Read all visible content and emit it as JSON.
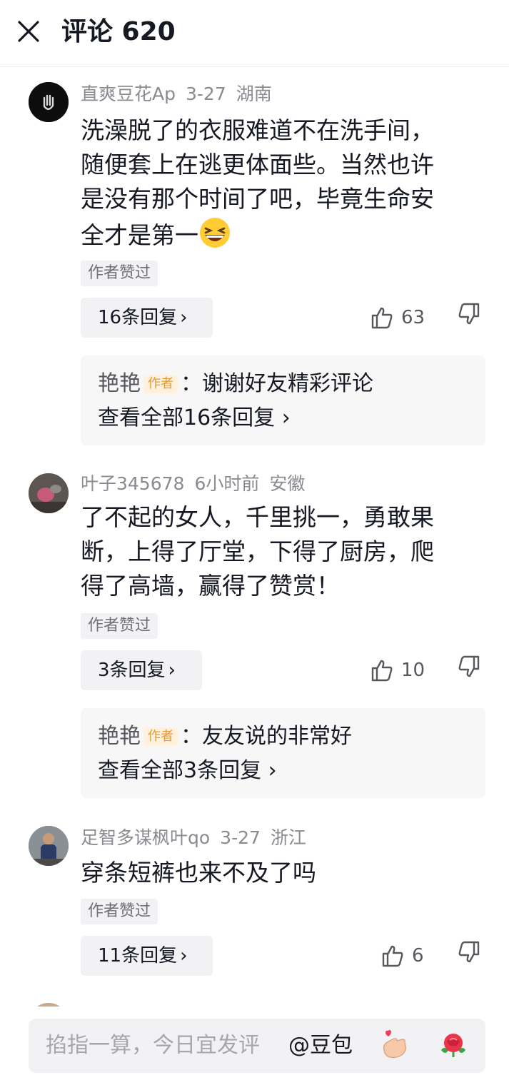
{
  "header": {
    "title": "评论 620"
  },
  "comments": [
    {
      "user": "直爽豆花Ap",
      "date": "3-27",
      "location": "湖南",
      "lines": [
        "洗澡脱了的衣服难道不在洗手间，",
        "随便套上在逃更体面些。当然也许",
        "是没有那个时间了吧，毕竟生命安",
        "全才是第一"
      ],
      "emoji": "grinning-squint-emoji",
      "author_liked": "作者赞过",
      "reply_button": "16条回复",
      "likes": "63",
      "preview": {
        "name": "艳艳",
        "tag": "作者",
        "text": "：谢谢好友精彩评论",
        "see_all": "查看全部16条回复"
      }
    },
    {
      "user": "叶子345678",
      "date": "6小时前",
      "location": "安徽",
      "lines": [
        "了不起的女人，千里挑一，勇敢果",
        "断，上得了厅堂，下得了厨房，爬",
        "得了高墙，赢得了赞赏！"
      ],
      "author_liked": "作者赞过",
      "reply_button": "3条回复",
      "likes": "10",
      "preview": {
        "name": "艳艳",
        "tag": "作者",
        "text": "：友友说的非常好",
        "see_all": "查看全部3条回复"
      }
    },
    {
      "user": "足智多谋枫叶qo",
      "date": "3-27",
      "location": "浙江",
      "lines": [
        "穿条短裤也来不及了吗"
      ],
      "author_liked": "作者赞过",
      "reply_button": "11条回复",
      "likes": "6"
    }
  ],
  "footer": {
    "placeholder": "掐指一算，今日宜发评",
    "mention": "@豆包"
  },
  "colors": {
    "text_primary": "#161823",
    "text_secondary": "#8a8b91",
    "chip_bg": "#f2f2f4",
    "author_tag": "#e39a3a"
  }
}
